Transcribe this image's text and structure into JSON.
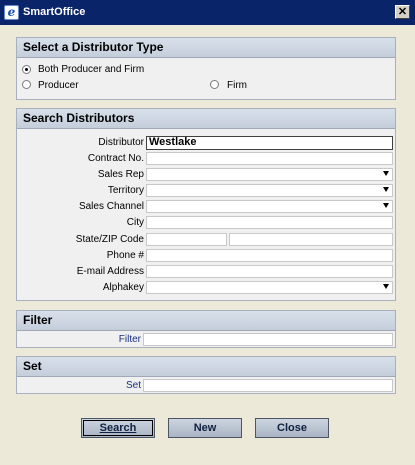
{
  "window": {
    "title": "SmartOffice",
    "close_glyph": "✕"
  },
  "distributor_type": {
    "header": "Select a Distributor Type",
    "options": [
      {
        "label": "Both Producer and Firm",
        "selected": true
      },
      {
        "label": "Producer",
        "selected": false
      },
      {
        "label": "Firm",
        "selected": false
      }
    ]
  },
  "search": {
    "header": "Search Distributors",
    "fields": {
      "distributor": {
        "label": "Distributor",
        "value": "Westlake"
      },
      "contract_no": {
        "label": "Contract No.",
        "value": ""
      },
      "sales_rep": {
        "label": "Sales Rep",
        "value": ""
      },
      "territory": {
        "label": "Territory",
        "value": ""
      },
      "sales_channel": {
        "label": "Sales Channel",
        "value": ""
      },
      "city": {
        "label": "City",
        "value": ""
      },
      "state_zip": {
        "label": "State/ZIP Code",
        "state": "",
        "zip": ""
      },
      "phone": {
        "label": "Phone #",
        "value": ""
      },
      "email": {
        "label": "E-mail Address",
        "value": ""
      },
      "alphakey": {
        "label": "Alphakey",
        "value": ""
      }
    }
  },
  "filter": {
    "header": "Filter",
    "label": "Filter",
    "value": ""
  },
  "set": {
    "header": "Set",
    "label": "Set",
    "value": ""
  },
  "buttons": {
    "search": "Search",
    "new": "New",
    "close": "Close"
  }
}
